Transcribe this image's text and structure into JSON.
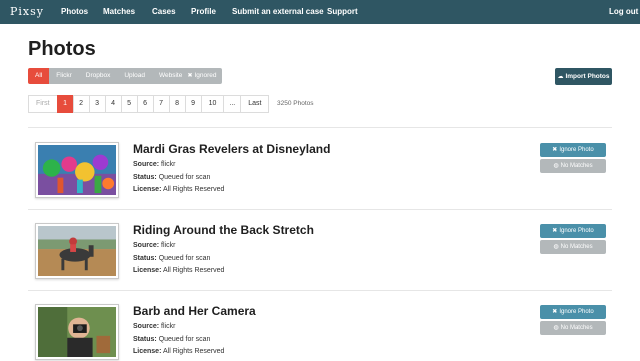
{
  "navbar": {
    "brand": "Pixsy",
    "items": [
      "Photos",
      "Matches",
      "Cases",
      "Profile",
      "Submit an external case",
      "Support"
    ],
    "logout": "Log out"
  },
  "page_title": "Photos",
  "filters": [
    "All",
    "Flickr",
    "Dropbox",
    "Upload",
    "Website"
  ],
  "ignored_label": "Ignored",
  "import_label": "Import Photos",
  "pagination": [
    "First",
    "1",
    "2",
    "3",
    "4",
    "5",
    "6",
    "7",
    "8",
    "9",
    "10",
    "...",
    "Last"
  ],
  "active_page": "1",
  "photo_count": "3250 Photos",
  "labels": {
    "source": "Source:",
    "status": "Status:",
    "license": "License:",
    "ignore_photo": "Ignore Photo",
    "no_matches": "No Matches"
  },
  "photos": [
    {
      "title": "Mardi Gras Revelers at Disneyland",
      "source": "flickr",
      "status": "Queued for scan",
      "license": "All Rights Reserved"
    },
    {
      "title": "Riding Around the Back Stretch",
      "source": "flickr",
      "status": "Queued for scan",
      "license": "All Rights Reserved"
    },
    {
      "title": "Barb and Her Camera",
      "source": "flickr",
      "status": "Queued for scan",
      "license": "All Rights Reserved"
    }
  ],
  "colors": {
    "navbar": "#2f5663",
    "active": "#e74c3c",
    "ignore_button": "#4a90a9",
    "muted_button": "#b3b8ba"
  }
}
